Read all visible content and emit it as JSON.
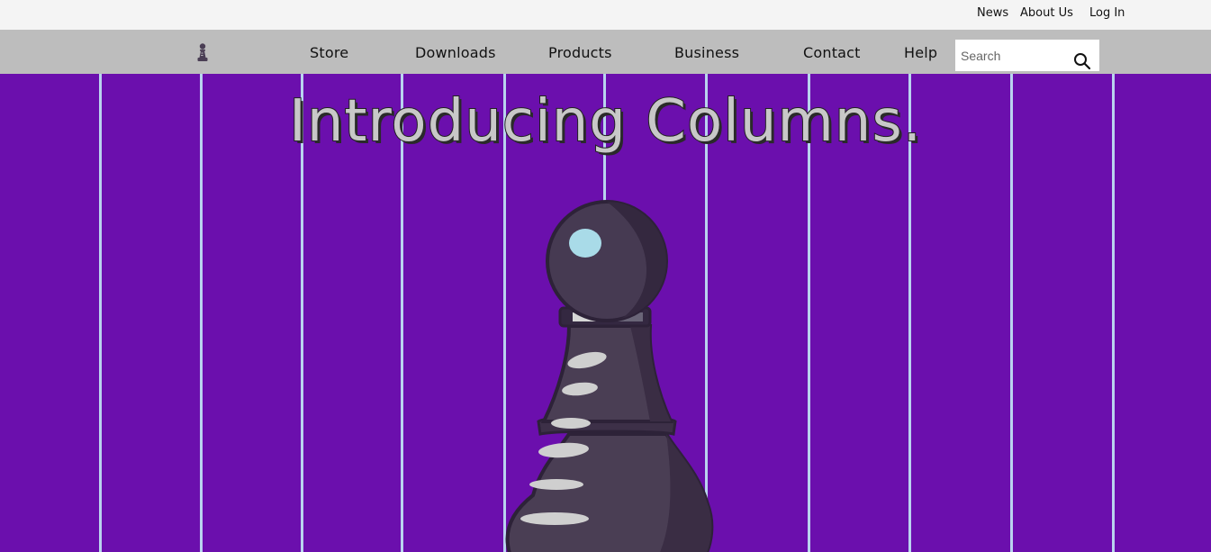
{
  "top_links": {
    "news": "News",
    "about": "About Us",
    "login": "Log In"
  },
  "nav": {
    "store": "Store",
    "downloads": "Downloads",
    "products": "Products",
    "business": "Business",
    "contact": "Contact",
    "help": "Help"
  },
  "search": {
    "placeholder": "Search"
  },
  "hero": {
    "headline": "Introducing Columns."
  },
  "colors": {
    "hero_background": "#6b0fad",
    "top_bar": "#f4f4f4",
    "nav_bar": "#bdbdbd",
    "column_lines": "#b9d3ef"
  },
  "icons": {
    "logo": "pawn-logo-icon",
    "search": "search-icon",
    "hero": "pawn-illustration"
  }
}
